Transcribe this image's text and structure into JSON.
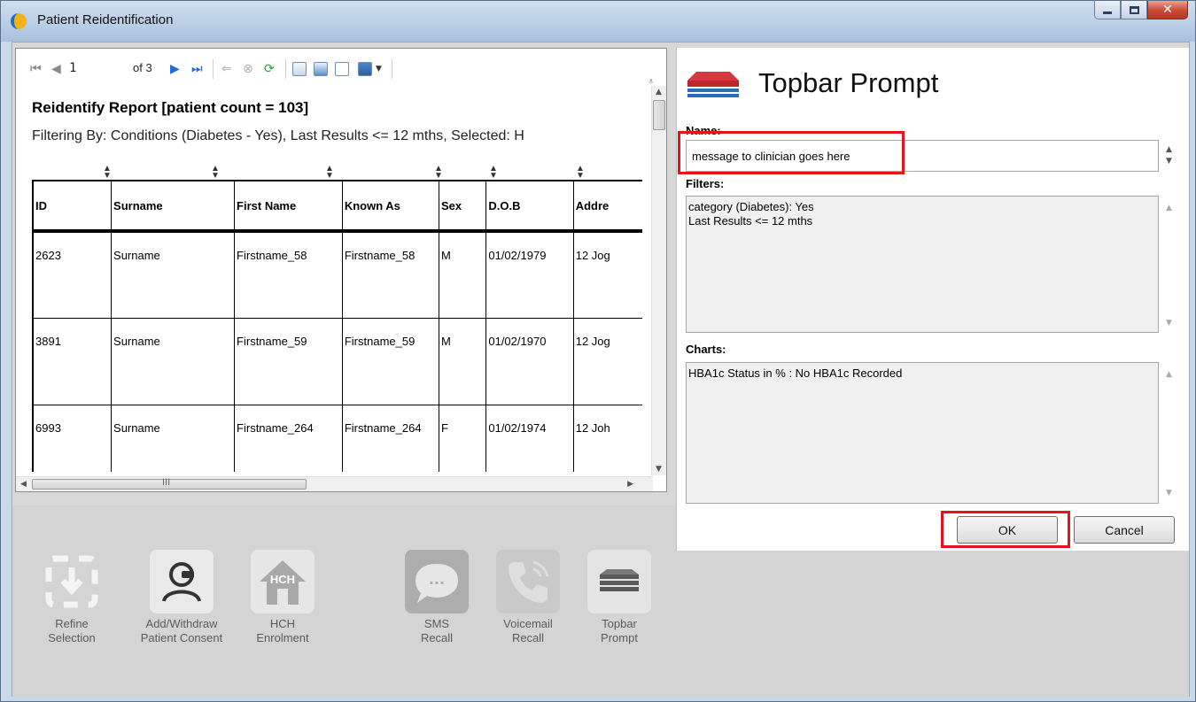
{
  "window": {
    "title": "Patient Reidentification"
  },
  "toolbar": {
    "page": "1",
    "page_of": "of 3"
  },
  "report": {
    "title": "Reidentify Report  [patient count = 103]",
    "filter": "Filtering By: Conditions (Diabetes - Yes), Last Results <= 12 mths, Selected: H",
    "columns": [
      "ID",
      "Surname",
      "First Name",
      "Known As",
      "Sex",
      "D.O.B",
      "Addre"
    ],
    "rows": [
      [
        "2623",
        "Surname",
        "Firstname_58",
        "Firstname_58",
        "M",
        "01/02/1979",
        "12 Jog"
      ],
      [
        "3891",
        "Surname",
        "Firstname_59",
        "Firstname_59",
        "M",
        "01/02/1970",
        "12 Jog"
      ],
      [
        "6993",
        "Surname",
        "Firstname_264",
        "Firstname_264",
        "F",
        "01/02/1974",
        "12 Joh"
      ]
    ],
    "hscroll_text": "III"
  },
  "actions": [
    {
      "id": "refine",
      "line1": "Refine",
      "line2": "Selection",
      "icon": "download-tray-icon"
    },
    {
      "id": "consent",
      "line1": "Add/Withdraw",
      "line2": "Patient Consent",
      "icon": "person-consent-icon"
    },
    {
      "id": "hch",
      "line1": "HCH",
      "line2": "Enrolment",
      "icon": "house-icon",
      "badge": "HCH"
    },
    {
      "id": "sms",
      "line1": "SMS",
      "line2": "Recall",
      "icon": "chat-bubble-icon",
      "badge": "..."
    },
    {
      "id": "voicemail",
      "line1": "Voicemail",
      "line2": "Recall",
      "icon": "phone-icon"
    },
    {
      "id": "topbar",
      "line1": "Topbar",
      "line2": "Prompt",
      "icon": "stack-icon"
    }
  ],
  "dialog": {
    "title": "Topbar Prompt",
    "name_label": "Name:",
    "name_value": "message to clinician goes here",
    "filters_label": "Filters:",
    "filters_lines": [
      "category (Diabetes): Yes",
      "Last Results <= 12 mths"
    ],
    "charts_label": "Charts:",
    "charts_lines": [
      "HBA1c Status in % : No HBA1c Recorded"
    ],
    "ok_label": "OK",
    "cancel_label": "Cancel"
  },
  "colors": {
    "highlight": "#e3141e",
    "logo_red": "#c0262c",
    "logo_blue": "#2a6fb5"
  }
}
